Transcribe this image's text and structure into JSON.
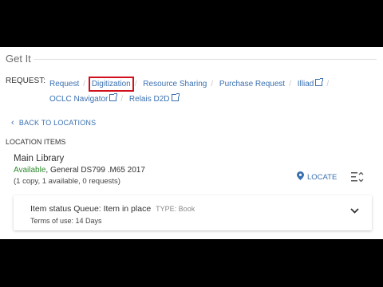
{
  "section_title": "Get It",
  "request": {
    "label": "REQUEST:",
    "links": [
      {
        "label": "Request"
      },
      {
        "label": "Digitization",
        "highlighted": true
      },
      {
        "label": "Resource Sharing"
      },
      {
        "label": "Purchase Request"
      },
      {
        "label": "Illiad",
        "external": true
      },
      {
        "label": "OCLC Navigator",
        "external": true
      },
      {
        "label": "Relais D2D",
        "external": true
      }
    ]
  },
  "back_label": "BACK TO LOCATIONS",
  "location_items_label": "LOCATION ITEMS",
  "location": {
    "library": "Main Library",
    "availability": "Available",
    "call_number": ", General DS799 .M65 2017",
    "copies": "(1 copy, 1 available, 0 requests)",
    "locate_label": "LOCATE"
  },
  "item": {
    "status": "Item status Queue: Item in place",
    "type": "TYPE: Book",
    "terms": "Terms of use: 14 Days"
  },
  "colors": {
    "link": "#3a70b0",
    "available": "#2e8b2e",
    "highlight": "#d0101a"
  }
}
